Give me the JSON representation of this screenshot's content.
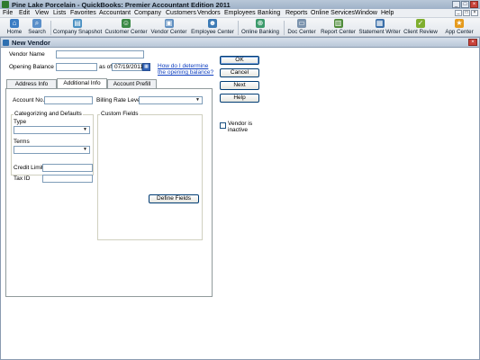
{
  "app": {
    "title": "Pine Lake Porcelain  - QuickBooks: Premier Accountant Edition 2011"
  },
  "menu": [
    "File",
    "Edit",
    "View",
    "Lists",
    "Favorites",
    "Accountant",
    "Company",
    "Customers",
    "Vendors",
    "Employees",
    "Banking",
    "Reports",
    "Online Services",
    "Window",
    "Help"
  ],
  "toolbar": [
    {
      "label": "Home",
      "icon": "home-icon"
    },
    {
      "label": "Search",
      "icon": "search-icon"
    },
    {
      "label": "Company Snapshot",
      "icon": "snapshot-icon"
    },
    {
      "label": "Customer Center",
      "icon": "customer-icon"
    },
    {
      "label": "Vendor Center",
      "icon": "vendor-icon"
    },
    {
      "label": "Employee Center",
      "icon": "employee-icon"
    },
    {
      "label": "Online Banking",
      "icon": "online-banking-icon"
    },
    {
      "label": "Doc Center",
      "icon": "doc-icon"
    },
    {
      "label": "Report Center",
      "icon": "report-icon"
    },
    {
      "label": "Statement Writer",
      "icon": "statement-icon"
    },
    {
      "label": "Client Review",
      "icon": "client-review-icon"
    },
    {
      "label": "App Center",
      "icon": "app-center-icon"
    }
  ],
  "window": {
    "title": "New Vendor"
  },
  "form": {
    "vendor_name_label": "Vendor Name",
    "vendor_name_value": "",
    "opening_balance_label": "Opening Balance",
    "opening_balance_value": "",
    "as_of_label": "as of",
    "as_of_date": "07/19/2011",
    "help_link_line1": "How do I determine",
    "help_link_line2": "the opening balance?"
  },
  "tabs": [
    "Address Info",
    "Additional Info",
    "Account Prefill"
  ],
  "active_tab": "Additional Info",
  "additional": {
    "account_no_label": "Account No.",
    "account_no_value": "",
    "billing_rate_label": "Billing Rate Level",
    "categorizing_title": "Categorizing and Defaults",
    "type_label": "Type",
    "terms_label": "Terms",
    "credit_limit_label": "Credit Limit",
    "tax_id_label": "Tax ID",
    "custom_fields_title": "Custom Fields",
    "define_fields_label": "Define Fields"
  },
  "buttons": {
    "ok": "OK",
    "cancel": "Cancel",
    "next": "Next",
    "help": "Help"
  },
  "inactive": {
    "label_line1": "Vendor is",
    "label_line2": "inactive",
    "checked": false
  },
  "colors": {
    "titlebar": "#9fb2c8",
    "link": "#1040c0",
    "button_border": "#003c74"
  }
}
